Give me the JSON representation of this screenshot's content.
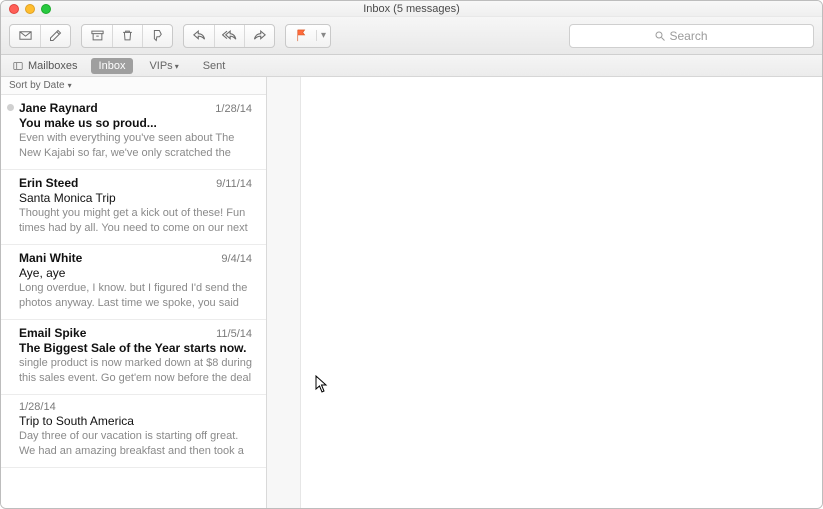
{
  "window": {
    "title": "Inbox (5 messages)"
  },
  "search": {
    "placeholder": "Search"
  },
  "favbar": {
    "mailboxes": "Mailboxes",
    "tabs": [
      {
        "label": "Inbox",
        "selected": true
      },
      {
        "label": "VIPs",
        "dropdown": true
      },
      {
        "label": "Sent"
      }
    ]
  },
  "sortbar": {
    "label": "Sort by Date"
  },
  "messages": [
    {
      "unread": true,
      "from": "Jane Raynard",
      "date": "1/28/14",
      "subject": "You make us so proud...",
      "subject_bold": true,
      "preview": "Even with everything you've seen about The New Kajabi so far, we've only scratched the surface on"
    },
    {
      "from": "Erin Steed",
      "date": "9/11/14",
      "subject": "Santa Monica Trip",
      "preview": "Thought you might get a kick out of these! Fun times had by all. You need to come on our next trip later..."
    },
    {
      "from": "Mani White",
      "date": "9/4/14",
      "subject": "Aye, aye",
      "preview": "Long overdue, I know. but I figured I'd send the photos anyway. Last time we spoke, you said you..."
    },
    {
      "from": "Email Spike",
      "date": "11/5/14",
      "subject": "The Biggest Sale of the Year starts now.",
      "subject_bold": true,
      "preview": "single product is now marked down at $8 during this sales event. Go get'em now before the deal"
    },
    {
      "no_sender": true,
      "from": "",
      "date": "1/28/14",
      "subject": "Trip to South America",
      "preview": "Day three of our vacation is starting off great. We had an amazing breakfast and then took a hike. I..."
    }
  ]
}
